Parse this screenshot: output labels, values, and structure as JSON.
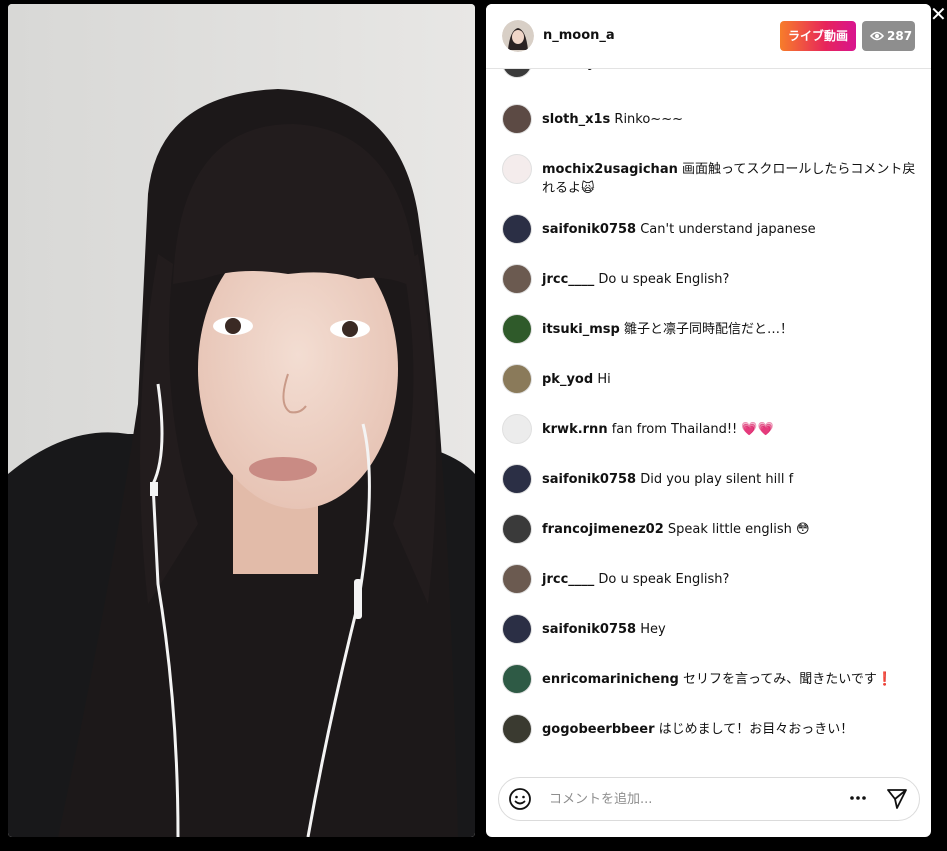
{
  "stream": {
    "host_username": "n_moon_a",
    "live_label": "ライブ動画",
    "viewer_count": "287",
    "close_symbol": "✕"
  },
  "comments": [
    {
      "user": "francojimenez02",
      "text": "😍😈😈😈",
      "avatar_color": "#3a3a3a"
    },
    {
      "user": "sloth_x1s",
      "text": "Rinko~~~",
      "avatar_color": "#5c4a44"
    },
    {
      "user": "mochix2usagichan",
      "text": "画面触ってスクロールしたらコメント戻れるよ🙀",
      "avatar_color": "#f4ecec"
    },
    {
      "user": "saifonik0758",
      "text": "Can't understand japanese",
      "avatar_color": "#2b2f45"
    },
    {
      "user": "jrcc____",
      "text": "Do u speak English?",
      "avatar_color": "#6b5a50"
    },
    {
      "user": "itsuki_msp",
      "text": "雛子と凛子同時配信だと…！",
      "avatar_color": "#2f5a2a"
    },
    {
      "user": "pk_yod",
      "text": "Hi",
      "avatar_color": "#8a7a5a"
    },
    {
      "user": "krwk.rnn",
      "text": "fan from Thailand!! 💗💗",
      "avatar_color": "#ececec"
    },
    {
      "user": "saifonik0758",
      "text": "Did you play silent hill f",
      "avatar_color": "#2b2f45"
    },
    {
      "user": "francojimenez02",
      "text": "Speak little english 😳",
      "avatar_color": "#3a3a3a"
    },
    {
      "user": "jrcc____",
      "text": "Do u speak English?",
      "avatar_color": "#6b5a50"
    },
    {
      "user": "saifonik0758",
      "text": "Hey",
      "avatar_color": "#2b2f45"
    },
    {
      "user": "enricomarinicheng",
      "text": "セリフを言ってみ、聞きたいです❗",
      "avatar_color": "#2e5a45"
    },
    {
      "user": "gogobeerbbeer",
      "text": "はじめまして！お目々おっきい！",
      "avatar_color": "#3a3a30"
    }
  ],
  "composer": {
    "placeholder": "コメントを追加...",
    "emoji_icon": "smiley-icon",
    "more_icon": "more-horizontal-icon",
    "send_icon": "paper-plane-icon"
  },
  "colors": {
    "live_gradient_start": "#f77d2a",
    "live_gradient_end": "#d8148f",
    "viewer_badge": "#8e8e8e"
  }
}
